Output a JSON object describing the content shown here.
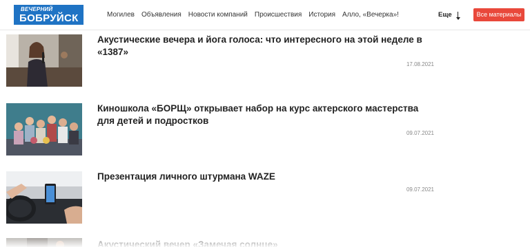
{
  "header": {
    "logo_line1": "ВЕЧЕРНИЙ",
    "logo_line2": "БОБРУЙСК",
    "nav": [
      "Могилев",
      "Объявления",
      "Новости компаний",
      "Происшествия",
      "История",
      "Алло, «Вечерка»!"
    ],
    "more_label": "Еще",
    "all_materials_label": "Все материалы"
  },
  "articles": [
    {
      "title": "Акустические вечера и йога голоса: что интересного на этой неделе в «1387»",
      "date": "17.08.2021"
    },
    {
      "title": "Киношкола «БОРЩ» открывает набор на курс актерского мастерства для детей и подростков",
      "date": "09.07.2021"
    },
    {
      "title": "Презентация личного штурмана WAZE",
      "date": "09.07.2021"
    },
    {
      "title": "Акустический вечер «Замечая солнце»",
      "date": ""
    }
  ],
  "colors": {
    "accent": "#e9483b",
    "logo_bg": "#1f73c4"
  }
}
